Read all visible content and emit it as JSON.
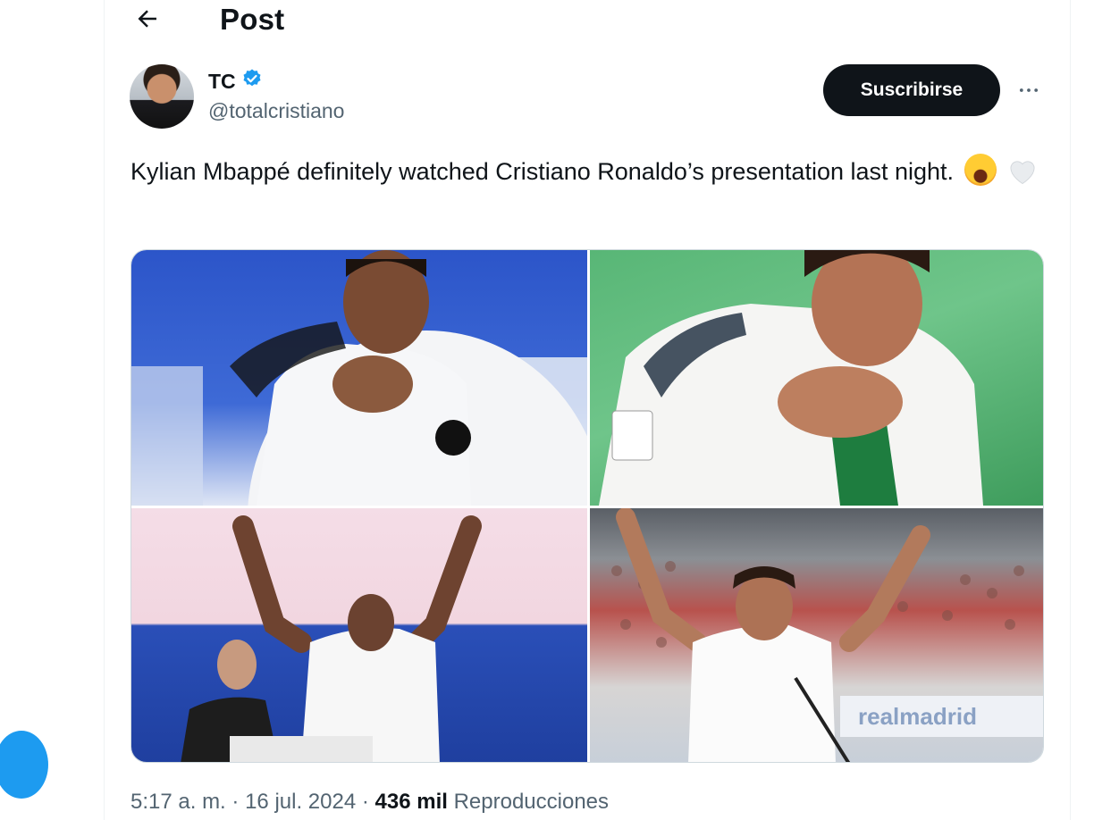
{
  "header": {
    "title": "Post"
  },
  "author": {
    "name": "TC",
    "handle": "@totalcristiano",
    "verified": true
  },
  "subscribe_label": "Suscribirse",
  "tweet": {
    "text": "Kylian Mbappé definitely watched Cristiano Ronaldo’s presentation last night.",
    "emojis": [
      "face-with-tears-of-joy",
      "white-heart"
    ]
  },
  "media": {
    "photos": [
      {
        "label": "mbappe-kissing-badge"
      },
      {
        "label": "ronaldo-kissing-badge"
      },
      {
        "label": "mbappe-arms-raised"
      },
      {
        "label": "ronaldo-arms-raised",
        "sign_text": "realmadrid"
      }
    ]
  },
  "meta": {
    "time": "5:17 a. m.",
    "date": "16 jul. 2024",
    "views_count": "436 mil",
    "views_label": "Reproducciones",
    "sep": "·"
  },
  "colors": {
    "accent": "#1d9bf0",
    "text": "#0f1419",
    "secondary": "#536471"
  }
}
